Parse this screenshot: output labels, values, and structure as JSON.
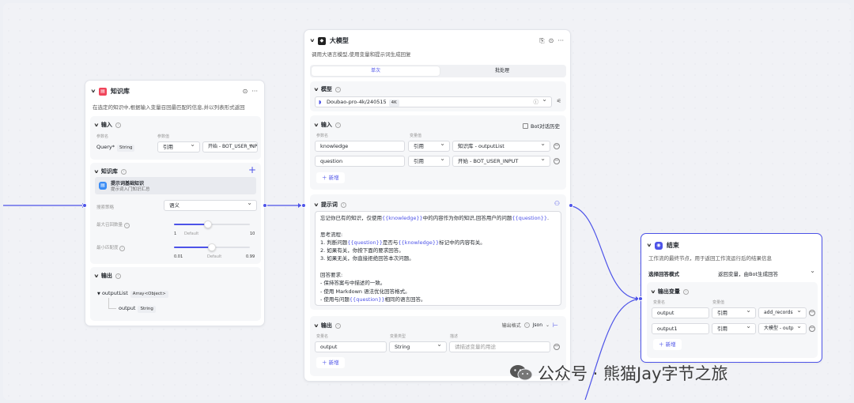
{
  "knowledge_node": {
    "title": "知识库",
    "desc": "在选定的知识中,根据输入变量召回最匹配的信息,并以列表形式返回",
    "input": {
      "title": "输入",
      "col_name": "参数名",
      "col_value": "参数值",
      "param_name": "Query*",
      "param_type": "String",
      "ref": "引用",
      "value": "开始 - BOT_USER_INPUT"
    },
    "kb": {
      "title": "知识库",
      "item_name": "提示词基础知识",
      "item_desc": "提示词入门知识汇总",
      "strategy_label": "搜索策略",
      "strategy_value": "语义",
      "max_recall_label": "最大召回数量",
      "max_min": "1",
      "max_default": "Default",
      "max_max": "10",
      "max_value": 5,
      "min_score_label": "最小匹配度",
      "score_min": "0.01",
      "score_default": "Default",
      "score_max": "0.99",
      "score_value": 0.5
    },
    "output": {
      "title": "输出",
      "list_name": "outputList",
      "list_type": "Array<Object>",
      "child_name": "output",
      "child_type": "String"
    }
  },
  "llm_node": {
    "title": "大模型",
    "desc": "调用大语言模型,使用变量和提示词生成回复",
    "tab_single": "单次",
    "tab_batch": "批处理",
    "model": {
      "title": "模型",
      "name": "Doubao-pro-4k/240515",
      "badge": "4K"
    },
    "input": {
      "title": "输入",
      "history_label": "Bot对话历史",
      "col_name": "参数名",
      "col_value": "变量值",
      "rows": [
        {
          "name": "knowledge",
          "ref": "引用",
          "value": "知识库 - outputList"
        },
        {
          "name": "question",
          "ref": "引用",
          "value": "开始 - BOT_USER_INPUT"
        }
      ],
      "add_label": "新增"
    },
    "prompt": {
      "title": "提示词",
      "lines": [
        {
          "parts": [
            "忘记你已有的知识，仅使用",
            "{{knowledge}}",
            "中的内容作为你的知识,回答用户的问题",
            "{{question}}",
            "."
          ]
        },
        {
          "parts": [
            ""
          ]
        },
        {
          "parts": [
            "思考流程:"
          ]
        },
        {
          "parts": [
            "1. 判断问题",
            "{{question}}",
            "是否与",
            "{{knowledge}}",
            "标记中的内容有关。"
          ]
        },
        {
          "parts": [
            "2. 如果有关，你按下面的要求回答。"
          ]
        },
        {
          "parts": [
            "3. 如果无关，你直接拒绝回答本次问题。"
          ]
        },
        {
          "parts": [
            ""
          ]
        },
        {
          "parts": [
            "回答要求:"
          ]
        },
        {
          "parts": [
            "- 保持答案与中描述的一致。"
          ]
        },
        {
          "parts": [
            "- 使用 Markdown 语法优化回答格式。"
          ]
        },
        {
          "parts": [
            "- 使用与问题",
            "{{question}}",
            "相同的语言回答。"
          ]
        }
      ]
    },
    "output": {
      "title": "输出",
      "format_label": "输出格式",
      "format_value": "Json",
      "col_name": "变量名",
      "col_type": "变量类型",
      "col_desc": "描述",
      "name": "output",
      "type": "String",
      "desc_placeholder": "请描述变量的用途",
      "add_label": "新增"
    }
  },
  "end_node": {
    "title": "结束",
    "desc": "工作流的最终节点，用于返回工作流运行后的结果信息",
    "mode_label": "选择回答模式",
    "mode_value": "返回变量，由Bot生成回答",
    "out_title": "输出变量",
    "col_name": "变量名",
    "col_value": "变量值",
    "rows": [
      {
        "name": "output",
        "ref": "引用",
        "value": "add_records"
      },
      {
        "name": "output1",
        "ref": "引用",
        "value": "大模型 - outp"
      }
    ],
    "add_label": "新增"
  },
  "watermark": "公众号 · 熊猫Jay字节之旅",
  "colors": {
    "accent": "#4d53e8",
    "kb_icon": "#f0445a",
    "end_icon": "#4d53e8"
  }
}
